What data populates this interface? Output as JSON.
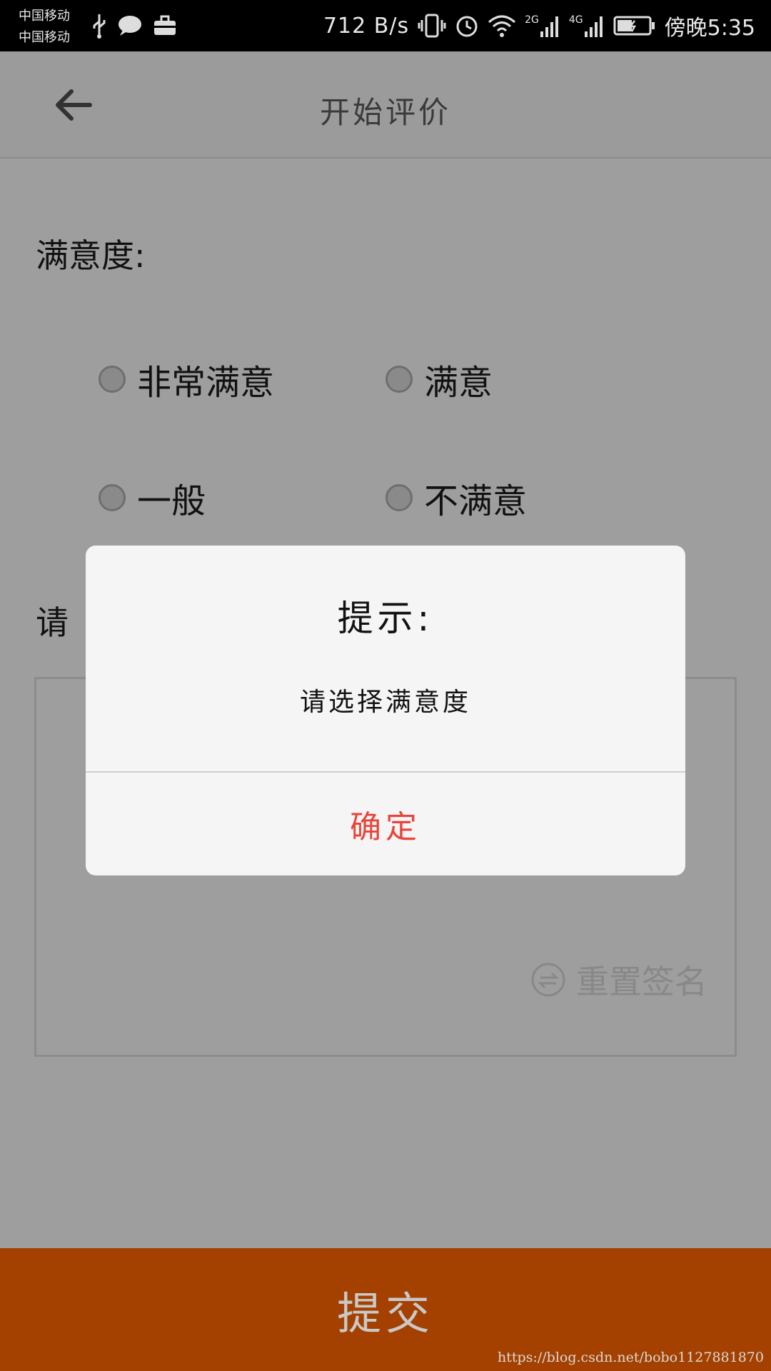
{
  "status_bar": {
    "carrier_1": "中国移动",
    "carrier_2": "中国移动",
    "net_speed": "712 B/s",
    "net_2g": "2G",
    "net_4g": "4G",
    "time": "傍晚5:35"
  },
  "app_bar": {
    "title": "开始评价",
    "back_icon": "arrow-left-icon"
  },
  "satisfaction": {
    "label": "满意度:",
    "options": [
      {
        "label": "非常满意",
        "checked": false
      },
      {
        "label": "满意",
        "checked": false
      },
      {
        "label": "一般",
        "checked": false
      },
      {
        "label": "不满意",
        "checked": false
      }
    ]
  },
  "signature": {
    "label_visible": "请",
    "reset_label": "重置签名",
    "reset_icon": "reset-icon"
  },
  "submit": {
    "label": "提交"
  },
  "dialog": {
    "title": "提示:",
    "message": "请选择满意度",
    "confirm_label": "确定"
  },
  "watermark": "https://blog.csdn.net/bobo1127881870",
  "colors": {
    "submit_bar": "#a44100",
    "confirm_text": "#e8443a",
    "overlay_background": "#9e9e9e",
    "dialog_background": "#f5f5f5"
  }
}
